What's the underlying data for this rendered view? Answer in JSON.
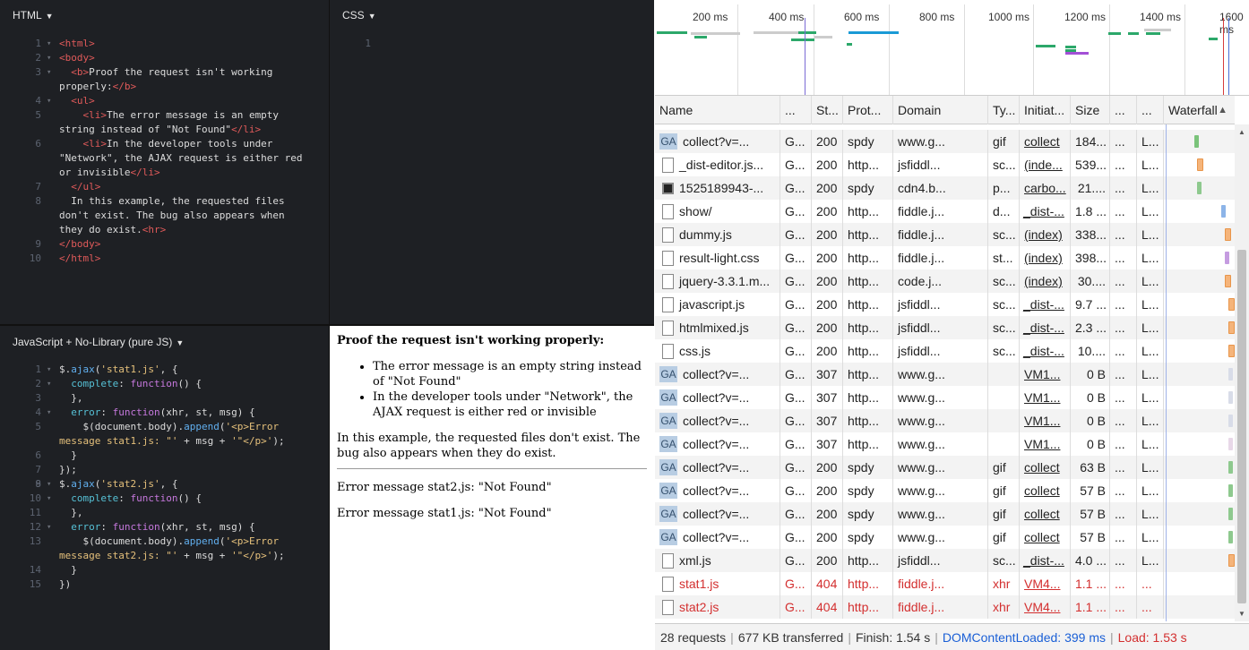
{
  "html_panel": {
    "title": "HTML",
    "lines": [
      {
        "num": "1",
        "fold": true,
        "html": "<span class='tag'>&lt;html&gt;</span>"
      },
      {
        "num": "2",
        "fold": true,
        "html": "<span class='tag'>&lt;body&gt;</span>"
      },
      {
        "num": "3",
        "fold": true,
        "html": "  <span class='tag'>&lt;b&gt;</span><span class='txt'>Proof the request isn't working</span>"
      },
      {
        "num": "",
        "fold": false,
        "html": "<span class='txt'>properly:</span><span class='tag'>&lt;/b&gt;</span>"
      },
      {
        "num": "4",
        "fold": true,
        "html": "  <span class='tag'>&lt;ul&gt;</span>"
      },
      {
        "num": "5",
        "fold": false,
        "html": "    <span class='tag'>&lt;li&gt;</span><span class='txt'>The error message is an empty</span>"
      },
      {
        "num": "",
        "fold": false,
        "html": "<span class='txt'>string instead of \"Not Found\"</span><span class='tag'>&lt;/li&gt;</span>"
      },
      {
        "num": "6",
        "fold": false,
        "html": "    <span class='tag'>&lt;li&gt;</span><span class='txt'>In the developer tools under</span>"
      },
      {
        "num": "",
        "fold": false,
        "html": "<span class='txt'>\"Network\", the AJAX request is either red</span>"
      },
      {
        "num": "",
        "fold": false,
        "html": "<span class='txt'>or invisible</span><span class='tag'>&lt;/li&gt;</span>"
      },
      {
        "num": "7",
        "fold": false,
        "html": "  <span class='tag'>&lt;/ul&gt;</span>"
      },
      {
        "num": "8",
        "fold": false,
        "html": "  <span class='txt'>In this example, the requested files</span>"
      },
      {
        "num": "",
        "fold": false,
        "html": "<span class='txt'>don't exist. The bug also appears when</span>"
      },
      {
        "num": "",
        "fold": false,
        "html": "<span class='txt'>they do exist.</span><span class='tag'>&lt;hr&gt;</span>"
      },
      {
        "num": "9",
        "fold": false,
        "html": "<span class='tag'>&lt;/body&gt;</span>"
      },
      {
        "num": "10",
        "fold": false,
        "html": "<span class='tag'>&lt;/html&gt;</span>"
      }
    ]
  },
  "css_panel": {
    "title": "CSS",
    "lines": [
      {
        "num": "1",
        "fold": false,
        "html": ""
      }
    ]
  },
  "js_panel": {
    "title": "JavaScript + No-Library (pure JS)",
    "lines": [
      {
        "num": "1",
        "fold": true,
        "html": "<span class='txt'>$.</span><span class='fn'>ajax</span><span class='txt'>(</span><span class='str'>'stat1.js'</span><span class='txt'>, {</span>"
      },
      {
        "num": "2",
        "fold": true,
        "html": "  <span class='prop'>complete</span><span class='txt'>: </span><span class='kw'>function</span><span class='txt'>() {</span>"
      },
      {
        "num": "3",
        "fold": false,
        "html": "  <span class='txt'>},</span>"
      },
      {
        "num": "4",
        "fold": true,
        "html": "  <span class='prop'>error</span><span class='txt'>: </span><span class='kw'>function</span><span class='txt'>(xhr, st, msg) {</span>"
      },
      {
        "num": "5",
        "fold": false,
        "html": "    <span class='txt'>$(document.body).</span><span class='fn'>append</span><span class='txt'>(</span><span class='str'>'&lt;p&gt;Error</span>"
      },
      {
        "num": "",
        "fold": false,
        "html": "<span class='str'>message stat1.js: \"'</span><span class='txt'> + msg + </span><span class='str'>'\"&lt;/p&gt;'</span><span class='txt'>);</span>"
      },
      {
        "num": "6",
        "fold": false,
        "html": "  <span class='txt'>}</span>"
      },
      {
        "num": "7",
        "fold": false,
        "html": "<span class='txt'>});</span>"
      },
      {
        "num": "8",
        "fold": false,
        "html": ""
      },
      {
        "num": "9",
        "fold": true,
        "html": "<span class='txt'>$.</span><span class='fn'>ajax</span><span class='txt'>(</span><span class='str'>'stat2.js'</span><span class='txt'>, {</span>"
      },
      {
        "num": "10",
        "fold": true,
        "html": "  <span class='prop'>complete</span><span class='txt'>: </span><span class='kw'>function</span><span class='txt'>() {</span>"
      },
      {
        "num": "11",
        "fold": false,
        "html": "  <span class='txt'>},</span>"
      },
      {
        "num": "12",
        "fold": true,
        "html": "  <span class='prop'>error</span><span class='txt'>: </span><span class='kw'>function</span><span class='txt'>(xhr, st, msg) {</span>"
      },
      {
        "num": "13",
        "fold": false,
        "html": "    <span class='txt'>$(document.body).</span><span class='fn'>append</span><span class='txt'>(</span><span class='str'>'&lt;p&gt;Error</span>"
      },
      {
        "num": "",
        "fold": false,
        "html": "<span class='str'>message stat2.js: \"'</span><span class='txt'> + msg + </span><span class='str'>'\"&lt;/p&gt;'</span><span class='txt'>);</span>"
      },
      {
        "num": "14",
        "fold": false,
        "html": "  <span class='txt'>}</span>"
      },
      {
        "num": "15",
        "fold": false,
        "html": "<span class='txt'>})</span>"
      }
    ]
  },
  "result": {
    "heading": "Proof the request isn't working properly:",
    "bullets": [
      "The error message is an empty string instead of \"Not Found\"",
      "In the developer tools under \"Network\", the AJAX request is either red or invisible"
    ],
    "paragraph": "In this example, the requested files don't exist. The bug also appears when they do exist.",
    "messages": [
      "Error message stat2.js: \"Not Found\"",
      "Error message stat1.js: \"Not Found\""
    ]
  },
  "devtools": {
    "overview_ticks": [
      "200 ms",
      "400 ms",
      "600 ms",
      "800 ms",
      "1000 ms",
      "1200 ms",
      "1400 ms",
      "1600 ms"
    ],
    "columns": {
      "name": "Name",
      "method": "...",
      "status": "St...",
      "protocol": "Prot...",
      "domain": "Domain",
      "type": "Ty...",
      "initiator": "Initiat...",
      "size": "Size",
      "extra1": "...",
      "extra2": "...",
      "waterfall": "Waterfall"
    },
    "rows": [
      {
        "icon": "ga",
        "name": "collect?v=...",
        "method": "G...",
        "status": "200",
        "protocol": "spdy",
        "domain": "www.g...",
        "type": "gif",
        "initiator": "collect",
        "size": "184...",
        "x2": "L...",
        "wf_frac": 0.45,
        "wf_color": "#7ac37a",
        "error": false
      },
      {
        "icon": "doc",
        "name": "_dist-editor.js...",
        "method": "G...",
        "status": "200",
        "protocol": "http...",
        "domain": "jsfiddl...",
        "type": "sc...",
        "initiator": "(inde...",
        "size": "539...",
        "x2": "L...",
        "wf_frac": 0.5,
        "wf_color": "#f5b47a",
        "error": false
      },
      {
        "icon": "img",
        "name": "1525189943-...",
        "method": "G...",
        "status": "200",
        "protocol": "spdy",
        "domain": "cdn4.b...",
        "type": "p...",
        "initiator": "carbo...",
        "size": "21....",
        "x2": "L...",
        "wf_frac": 0.5,
        "wf_color": "#8ec98e",
        "error": false
      },
      {
        "icon": "doc",
        "name": "show/",
        "method": "G...",
        "status": "200",
        "protocol": "http...",
        "domain": "fiddle.j...",
        "type": "d...",
        "initiator": "_dist-...",
        "size": "1.8 ...",
        "x2": "L...",
        "wf_frac": 0.88,
        "wf_color": "#8cb4e8",
        "error": false
      },
      {
        "icon": "doc",
        "name": "dummy.js",
        "method": "G...",
        "status": "200",
        "protocol": "http...",
        "domain": "fiddle.j...",
        "type": "sc...",
        "initiator": "(index)",
        "size": "338...",
        "x2": "L...",
        "wf_frac": 0.94,
        "wf_color": "#f5b47a",
        "error": false
      },
      {
        "icon": "doc",
        "name": "result-light.css",
        "method": "G...",
        "status": "200",
        "protocol": "http...",
        "domain": "fiddle.j...",
        "type": "st...",
        "initiator": "(index)",
        "size": "398...",
        "x2": "L...",
        "wf_frac": 0.94,
        "wf_color": "#c59ce0",
        "error": false
      },
      {
        "icon": "doc",
        "name": "jquery-3.3.1.m...",
        "method": "G...",
        "status": "200",
        "protocol": "http...",
        "domain": "code.j...",
        "type": "sc...",
        "initiator": "(index)",
        "size": "30....",
        "x2": "L...",
        "wf_frac": 0.94,
        "wf_color": "#f5b47a",
        "error": false
      },
      {
        "icon": "doc",
        "name": "javascript.js",
        "method": "G...",
        "status": "200",
        "protocol": "http...",
        "domain": "jsfiddl...",
        "type": "sc...",
        "initiator": "_dist-...",
        "size": "9.7 ...",
        "x2": "L...",
        "wf_frac": 1.0,
        "wf_color": "#f5b47a",
        "error": false
      },
      {
        "icon": "doc",
        "name": "htmlmixed.js",
        "method": "G...",
        "status": "200",
        "protocol": "http...",
        "domain": "jsfiddl...",
        "type": "sc...",
        "initiator": "_dist-...",
        "size": "2.3 ...",
        "x2": "L...",
        "wf_frac": 1.0,
        "wf_color": "#f5b47a",
        "error": false
      },
      {
        "icon": "doc",
        "name": "css.js",
        "method": "G...",
        "status": "200",
        "protocol": "http...",
        "domain": "jsfiddl...",
        "type": "sc...",
        "initiator": "_dist-...",
        "size": "10....",
        "x2": "L...",
        "wf_frac": 1.0,
        "wf_color": "#f5b47a",
        "error": false
      },
      {
        "icon": "ga",
        "name": "collect?v=...",
        "method": "G...",
        "status": "307",
        "protocol": "http...",
        "domain": "www.g...",
        "type": "",
        "initiator": "VM1...",
        "size": "0 B",
        "x2": "L...",
        "wf_frac": 1.0,
        "wf_color": "#d8dce8",
        "error": false
      },
      {
        "icon": "ga",
        "name": "collect?v=...",
        "method": "G...",
        "status": "307",
        "protocol": "http...",
        "domain": "www.g...",
        "type": "",
        "initiator": "VM1...",
        "size": "0 B",
        "x2": "L...",
        "wf_frac": 1.0,
        "wf_color": "#d8dce8",
        "error": false
      },
      {
        "icon": "ga",
        "name": "collect?v=...",
        "method": "G...",
        "status": "307",
        "protocol": "http...",
        "domain": "www.g...",
        "type": "",
        "initiator": "VM1...",
        "size": "0 B",
        "x2": "L...",
        "wf_frac": 1.0,
        "wf_color": "#d8dce8",
        "error": false
      },
      {
        "icon": "ga",
        "name": "collect?v=...",
        "method": "G...",
        "status": "307",
        "protocol": "http...",
        "domain": "www.g...",
        "type": "",
        "initiator": "VM1...",
        "size": "0 B",
        "x2": "L...",
        "wf_frac": 1.0,
        "wf_color": "#e8d8e8",
        "error": false
      },
      {
        "icon": "ga",
        "name": "collect?v=...",
        "method": "G...",
        "status": "200",
        "protocol": "spdy",
        "domain": "www.g...",
        "type": "gif",
        "initiator": "collect",
        "size": "63 B",
        "x2": "L...",
        "wf_frac": 1.0,
        "wf_color": "#8ec98e",
        "error": false
      },
      {
        "icon": "ga",
        "name": "collect?v=...",
        "method": "G...",
        "status": "200",
        "protocol": "spdy",
        "domain": "www.g...",
        "type": "gif",
        "initiator": "collect",
        "size": "57 B",
        "x2": "L...",
        "wf_frac": 1.0,
        "wf_color": "#8ec98e",
        "error": false
      },
      {
        "icon": "ga",
        "name": "collect?v=...",
        "method": "G...",
        "status": "200",
        "protocol": "spdy",
        "domain": "www.g...",
        "type": "gif",
        "initiator": "collect",
        "size": "57 B",
        "x2": "L...",
        "wf_frac": 1.0,
        "wf_color": "#8ec98e",
        "error": false
      },
      {
        "icon": "ga",
        "name": "collect?v=...",
        "method": "G...",
        "status": "200",
        "protocol": "spdy",
        "domain": "www.g...",
        "type": "gif",
        "initiator": "collect",
        "size": "57 B",
        "x2": "L...",
        "wf_frac": 1.0,
        "wf_color": "#8ec98e",
        "error": false
      },
      {
        "icon": "doc",
        "name": "xml.js",
        "method": "G...",
        "status": "200",
        "protocol": "http...",
        "domain": "jsfiddl...",
        "type": "sc...",
        "initiator": "_dist-...",
        "size": "4.0 ...",
        "x2": "L...",
        "wf_frac": 1.0,
        "wf_color": "#f5b47a",
        "error": false
      },
      {
        "icon": "doc",
        "name": "stat1.js",
        "method": "G...",
        "status": "404",
        "protocol": "http...",
        "domain": "fiddle.j...",
        "type": "xhr",
        "initiator": "VM4...",
        "size": "1.1 ...",
        "x2": "...",
        "wf_frac": null,
        "wf_color": "",
        "error": true
      },
      {
        "icon": "doc",
        "name": "stat2.js",
        "method": "G...",
        "status": "404",
        "protocol": "http...",
        "domain": "fiddle.j...",
        "type": "xhr",
        "initiator": "VM4...",
        "size": "1.1 ...",
        "x2": "...",
        "wf_frac": null,
        "wf_color": "",
        "error": true
      }
    ],
    "status_bar": {
      "requests": "28 requests",
      "transferred": "677 KB transferred",
      "finish": "Finish: 1.54 s",
      "dcl": "DOMContentLoaded: 399 ms",
      "load": "Load: 1.53 s"
    }
  }
}
